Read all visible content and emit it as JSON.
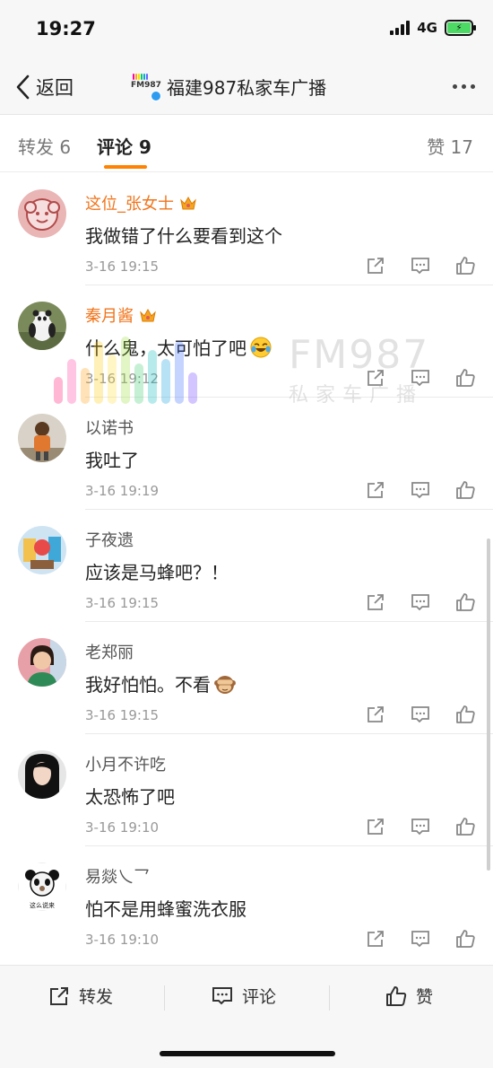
{
  "status": {
    "time": "19:27",
    "network": "4G"
  },
  "nav": {
    "back_label": "返回",
    "title": "福建987私家车广播",
    "logo_text": "FM987"
  },
  "tabs": {
    "repost": "转发 6",
    "comment": "评论 9",
    "like": "赞 17"
  },
  "watermark": {
    "main": "FM987",
    "sub": "私家车广播"
  },
  "comments": [
    {
      "user": "这位_张女士",
      "vip": true,
      "text": "我做错了什么要看到这个",
      "emoji": "",
      "time": "3-16 19:15"
    },
    {
      "user": "秦月酱",
      "vip": true,
      "text": "什么鬼，太可怕了吧",
      "emoji": "laughing-tears-emoji",
      "time": "3-16 19:12"
    },
    {
      "user": "以诺书",
      "vip": false,
      "text": "我吐了",
      "emoji": "",
      "time": "3-16 19:19"
    },
    {
      "user": "子夜遗",
      "vip": false,
      "text": "应该是马蜂吧？！",
      "emoji": "",
      "time": "3-16 19:15"
    },
    {
      "user": "老郑丽",
      "vip": false,
      "text": "我好怕怕。不看",
      "emoji": "see-no-evil-monkey-emoji",
      "time": "3-16 19:15"
    },
    {
      "user": "小月不许吃",
      "vip": false,
      "text": "太恐怖了吧",
      "emoji": "",
      "time": "3-16 19:10"
    },
    {
      "user": "易燚乀乛",
      "vip": false,
      "text": "怕不是用蜂蜜洗衣服",
      "emoji": "",
      "time": "3-16 19:10",
      "avatar_caption": "这么说来"
    }
  ],
  "bottom": {
    "repost": "转发",
    "comment": "评论",
    "like": "赞"
  },
  "colors": {
    "accent": "#ff8200",
    "vip_name": "#f0751c",
    "verified": "#2d9cf0"
  }
}
